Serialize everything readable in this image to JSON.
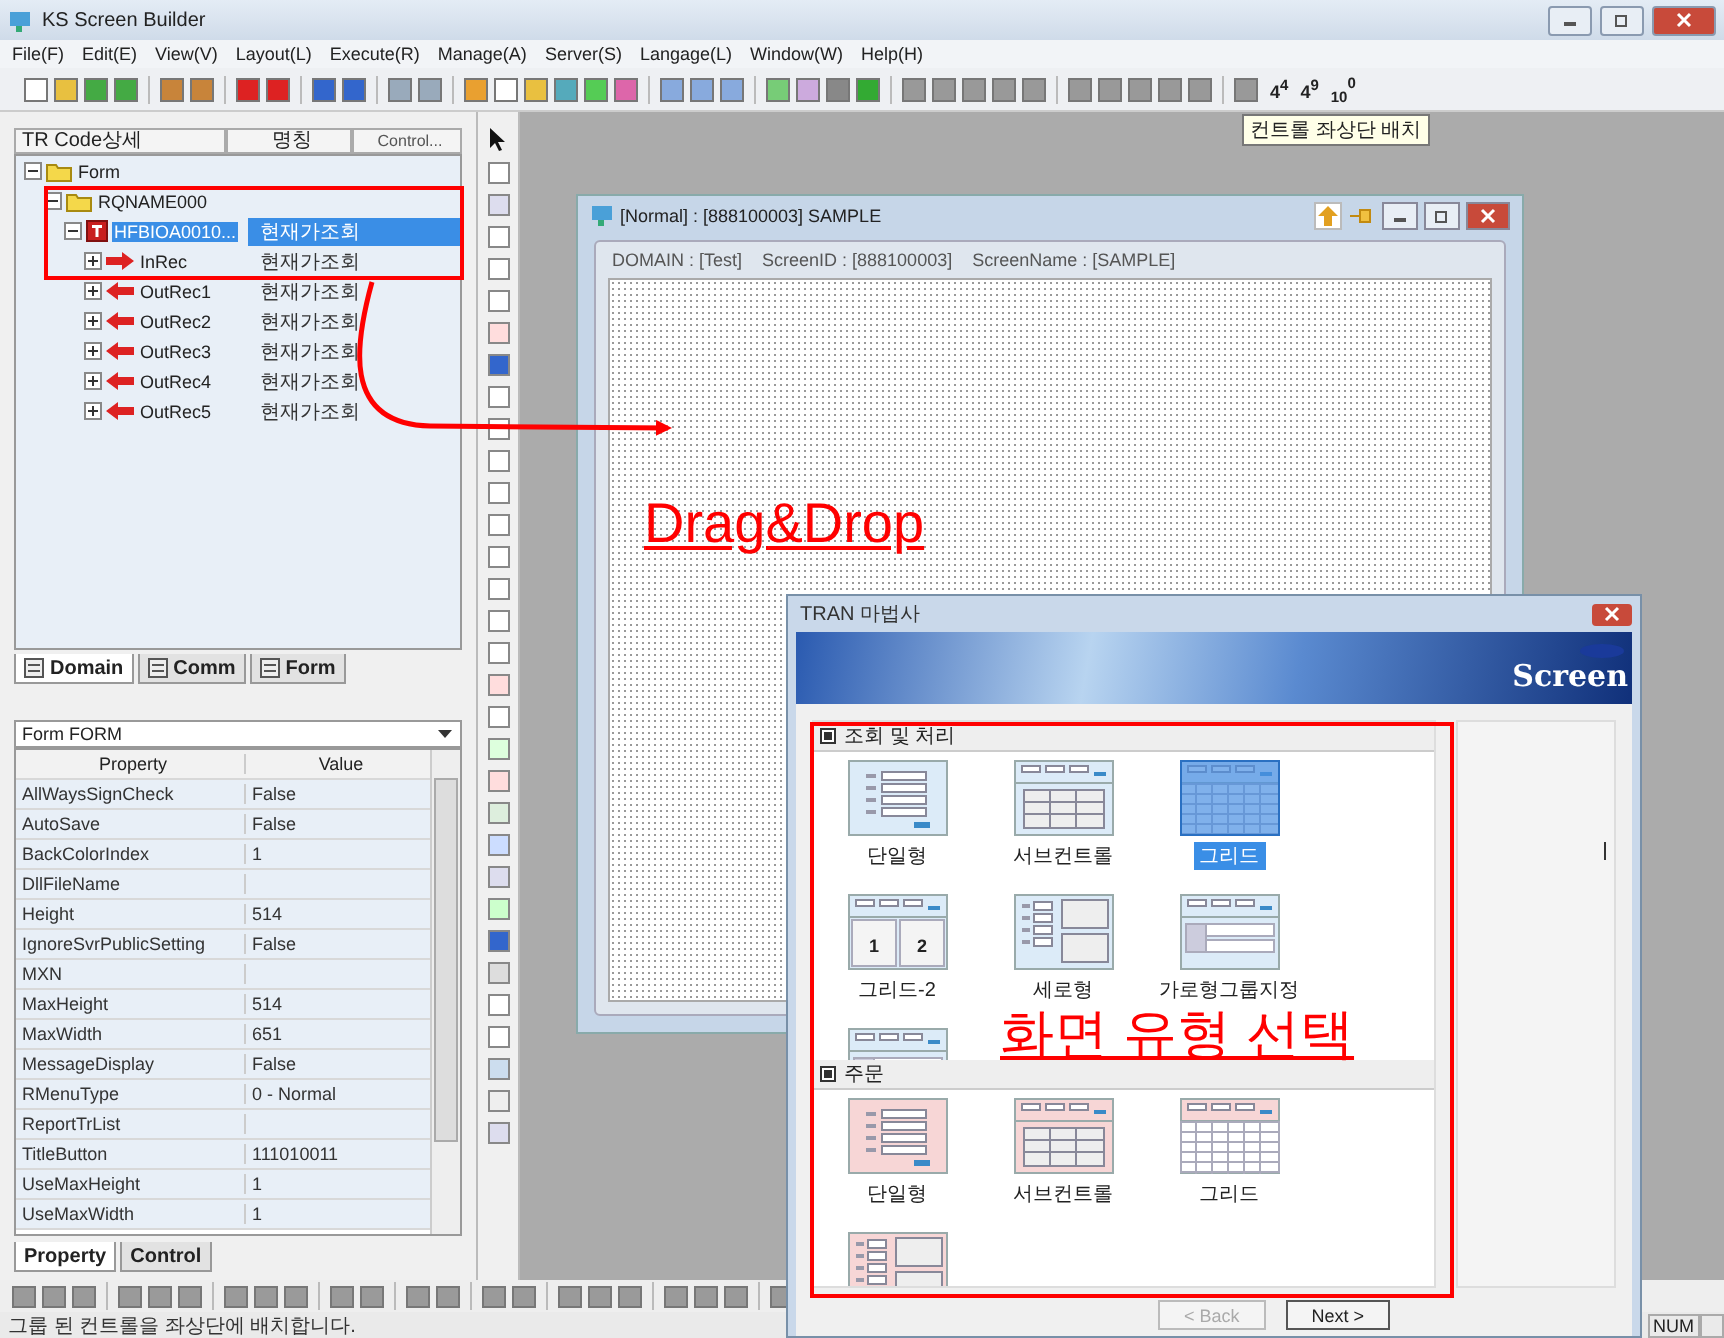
{
  "window": {
    "title": "KS Screen Builder"
  },
  "menu": [
    "File(F)",
    "Edit(E)",
    "View(V)",
    "Layout(L)",
    "Execute(R)",
    "Manage(A)",
    "Server(S)",
    "Langage(L)",
    "Window(W)",
    "Help(H)"
  ],
  "toolbar": {
    "counters": [
      "4$^{4}$",
      "4$^{9}$",
      "$_{10}$$^{0}$"
    ],
    "tooltip": "컨트롤 좌상단 배치"
  },
  "tree_panel": {
    "columns": [
      "TR Code상세",
      "명칭",
      "Control..."
    ],
    "nodes": [
      {
        "label": "Form",
        "kind": "folder",
        "expanded": true,
        "selected": false,
        "children": [
          {
            "label": "RQNAME000",
            "kind": "folder",
            "expanded": true,
            "selected": false,
            "children": [
              {
                "label": "HFBIOA0010...",
                "description": "현재가조회",
                "kind": "transaction",
                "expanded": true,
                "selected": true,
                "children": [
                  {
                    "label": "InRec",
                    "description": "현재가조회",
                    "kind": "input",
                    "expanded": false,
                    "selected": false
                  },
                  {
                    "label": "OutRec1",
                    "description": "현재가조회",
                    "kind": "output",
                    "expanded": false,
                    "selected": false
                  },
                  {
                    "label": "OutRec2",
                    "description": "현재가조회",
                    "kind": "output",
                    "expanded": false,
                    "selected": false
                  },
                  {
                    "label": "OutRec3",
                    "description": "현재가조회",
                    "kind": "output",
                    "expanded": false,
                    "selected": false
                  },
                  {
                    "label": "OutRec4",
                    "description": "현재가조회",
                    "kind": "output",
                    "expanded": false,
                    "selected": false
                  },
                  {
                    "label": "OutRec5",
                    "description": "현재가조회",
                    "kind": "output",
                    "expanded": false,
                    "selected": false
                  }
                ]
              }
            ]
          }
        ]
      }
    ],
    "tabs": [
      {
        "label": "Domain",
        "selected": true
      },
      {
        "label": "Comm",
        "selected": false
      },
      {
        "label": "Form",
        "selected": false
      }
    ]
  },
  "property_panel": {
    "object": "Form FORM",
    "columns": [
      "Property",
      "Value"
    ],
    "rows": [
      {
        "name": "AllWaysSignCheck",
        "value": "False"
      },
      {
        "name": "AutoSave",
        "value": "False"
      },
      {
        "name": "BackColorIndex",
        "value": "1"
      },
      {
        "name": "DllFileName"
      },
      {
        "name": "Height",
        "value": "514"
      },
      {
        "name": "IgnoreSvrPublicSetting",
        "value": "False"
      },
      {
        "name": "MXN"
      },
      {
        "name": "MaxHeight",
        "value": "514"
      },
      {
        "name": "MaxWidth",
        "value": "651"
      },
      {
        "name": "MessageDisplay",
        "value": "False"
      },
      {
        "name": "RMenuType",
        "value": "0 - Normal"
      },
      {
        "name": "ReportTrList"
      },
      {
        "name": "TitleButton",
        "value": "111010011"
      },
      {
        "name": "UseMaxHeight",
        "value": "1"
      },
      {
        "name": "UseMaxWidth",
        "value": "1"
      }
    ],
    "tabs": [
      {
        "label": "Property",
        "selected": true
      },
      {
        "label": "Control",
        "selected": false
      }
    ]
  },
  "document_window": {
    "title": "[Normal] : [888100003] SAMPLE",
    "info": [
      "DOMAIN : [Test]",
      "ScreenID : [888100003]",
      "ScreenName : [SAMPLE]"
    ]
  },
  "dialog": {
    "title": "TRAN 마법사",
    "banner": "Screen",
    "sections": [
      {
        "title": "조회 및 처리",
        "color": "#dcebf8",
        "items": [
          {
            "label": "단일형",
            "kind": "single",
            "selected": false
          },
          {
            "label": "서브컨트롤",
            "kind": "subcontrol",
            "selected": false
          },
          {
            "label": "그리드",
            "kind": "grid",
            "selected": true
          },
          {
            "label": "그리드-2",
            "kind": "grid2",
            "selected": false,
            "panes": [
              "1",
              "2"
            ]
          },
          {
            "label": "세로형",
            "kind": "vertical",
            "selected": false
          },
          {
            "label": "가로형그룹지정",
            "kind": "horizontal",
            "selected": false
          },
          {
            "kind": "horizontal",
            "selected": false
          }
        ]
      },
      {
        "title": "주문",
        "color": "#f7d6d6",
        "items": [
          {
            "label": "단일형",
            "kind": "single",
            "selected": false
          },
          {
            "label": "서브컨트롤",
            "kind": "subcontrol",
            "selected": false
          },
          {
            "label": "그리드",
            "kind": "grid",
            "selected": false
          },
          {
            "kind": "vertical",
            "selected": false
          }
        ]
      }
    ],
    "buttons": [
      {
        "label": "< Back",
        "disabled": true
      },
      {
        "label": "Next >",
        "disabled": false
      }
    ]
  },
  "annotations": {
    "drag_label": "Drag&Drop",
    "select_label": "화면 유형 선택"
  },
  "status_bar": {
    "message": "그룹 된 컨트롤을 좌상단에 배치합니다.",
    "indicator": "NUM"
  }
}
